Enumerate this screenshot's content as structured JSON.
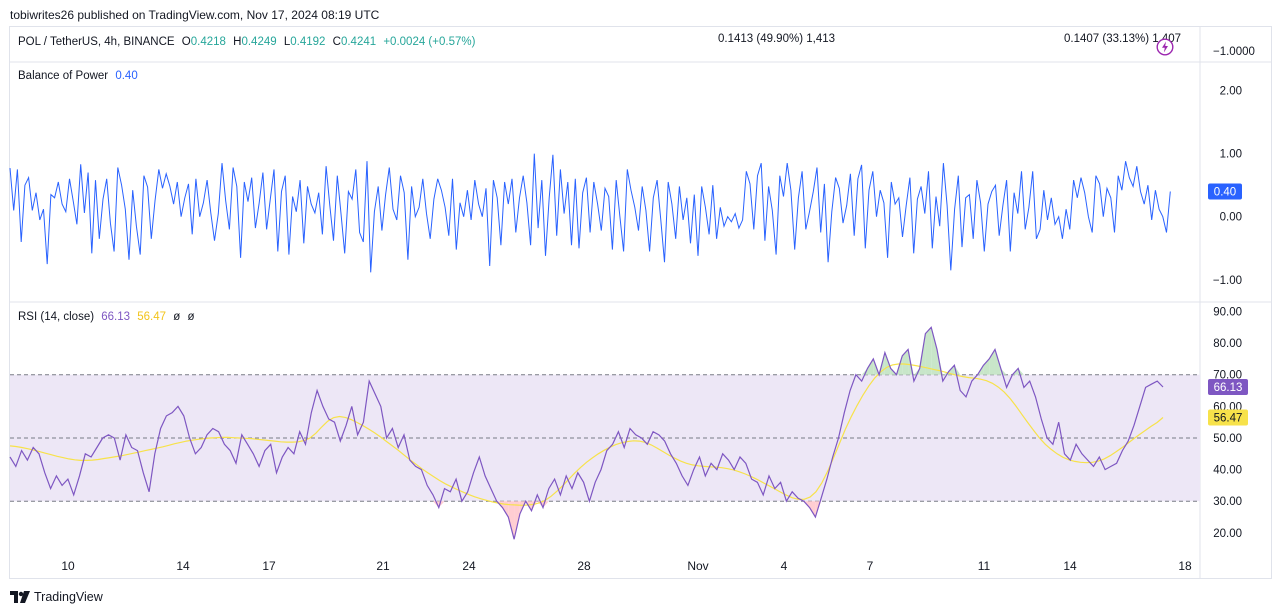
{
  "publisher_line": "tobiwrites26 published on TradingView.com, Nov 17, 2024 08:19 UTC",
  "header": {
    "symbol": "POL / TetherUS, 4h, BINANCE",
    "open_label": "O",
    "open": "0.4218",
    "high_label": "H",
    "high": "0.4249",
    "low_label": "L",
    "low": "0.4192",
    "close_label": "C",
    "close": "0.4241",
    "change": "+0.0024 (+0.57%)",
    "mid_info": "0.1413 (49.90%) 1,413",
    "right_info": "0.1407 (33.13%) 1,407",
    "right_axis_value": "−1.0000"
  },
  "colors": {
    "bop_line": "#2962ff",
    "rsi_line": "#7e57c2",
    "rsi_ma": "#f7e24a",
    "rsi_band": "#ede7f6",
    "overbought_fill": "#c8e6c9",
    "oversold_fill": "#ffcdd2",
    "gain": "#26a69a",
    "alert": "#9c27b0"
  },
  "footer": {
    "brand": "TradingView",
    "logo_icon": "tradingview-logo-icon"
  },
  "chart_data": [
    {
      "type": "line",
      "title": "Balance of Power",
      "current_value": "0.40",
      "yticks": [
        "2.00",
        "1.00",
        "0.00",
        "−1.00"
      ],
      "ylim": [
        -1.35,
        2.45
      ],
      "series": [
        {
          "values": [
            0.77,
            0.1,
            0.75,
            -0.4,
            0.5,
            0.62,
            0.1,
            0.38,
            -0.05,
            0.12,
            -0.75,
            0.35,
            0.3,
            0.55,
            0.2,
            0.08,
            0.6,
            0.25,
            -0.12,
            0.83,
            0.06,
            0.7,
            -0.58,
            0.58,
            -0.35,
            0.28,
            0.6,
            -0.1,
            -0.55,
            0.78,
            0.5,
            0.12,
            -0.68,
            0.42,
            -0.15,
            -0.6,
            0.65,
            0.47,
            -0.35,
            0.25,
            0.75,
            0.45,
            0.68,
            0.48,
            0.2,
            0.55,
            0.0,
            0.3,
            0.52,
            -0.28,
            0.6,
            0.0,
            0.22,
            0.58,
            0.06,
            -0.38,
            0.05,
            0.85,
            0.25,
            -0.2,
            0.78,
            0.48,
            -0.65,
            0.55,
            0.24,
            0.62,
            -0.18,
            0.22,
            0.7,
            -0.2,
            0.28,
            0.75,
            -0.55,
            0.4,
            0.65,
            -0.6,
            0.32,
            0.08,
            0.58,
            -0.42,
            0.48,
            0.2,
            0.06,
            0.38,
            -0.28,
            0.8,
            0.18,
            -0.38,
            0.65,
            0.05,
            -0.58,
            0.4,
            0.28,
            0.75,
            -0.25,
            -0.4,
            0.88,
            -0.88,
            0.08,
            0.48,
            -0.22,
            0.35,
            0.78,
            0.12,
            -0.05,
            0.65,
            0.38,
            -0.68,
            0.48,
            0.0,
            0.15,
            0.6,
            0.05,
            -0.35,
            0.28,
            0.6,
            0.42,
            0.15,
            -0.3,
            0.6,
            -0.52,
            0.22,
            0.0,
            0.42,
            -0.05,
            0.58,
            0.2,
            0.0,
            0.45,
            -0.78,
            0.58,
            0.3,
            -0.45,
            0.55,
            0.2,
            0.6,
            -0.25,
            0.3,
            0.65,
            0.22,
            -0.45,
            1.0,
            -0.18,
            0.58,
            -0.62,
            0.3,
            0.98,
            -0.3,
            0.75,
            0.05,
            0.55,
            -0.45,
            0.6,
            -0.5,
            0.38,
            0.62,
            -0.25,
            0.55,
            0.2,
            -0.22,
            0.45,
            0.32,
            -0.52,
            0.58,
            0.0,
            -0.55,
            0.75,
            0.42,
            0.15,
            -0.22,
            0.48,
            0.1,
            -0.55,
            0.3,
            0.58,
            -0.05,
            -0.72,
            0.55,
            0.2,
            -0.35,
            0.48,
            -0.05,
            0.3,
            -0.42,
            0.35,
            -0.62,
            0.48,
            0.15,
            -0.28,
            0.5,
            -0.35,
            0.15,
            -0.15,
            0.0,
            -0.08,
            0.05,
            -0.18,
            -0.05,
            0.72,
            0.52,
            -0.2,
            0.65,
            0.85,
            -0.38,
            0.48,
            0.1,
            -0.6,
            0.65,
            0.32,
            0.85,
            0.42,
            -0.52,
            0.3,
            0.72,
            -0.2,
            0.08,
            0.4,
            0.78,
            -0.25,
            0.52,
            -0.72,
            0.08,
            0.62,
            0.45,
            -0.1,
            0.18,
            0.68,
            -0.3,
            0.6,
            0.82,
            -0.5,
            0.42,
            0.72,
            0.0,
            0.42,
            0.22,
            -0.65,
            0.55,
            0.2,
            0.3,
            -0.32,
            0.18,
            0.62,
            -0.58,
            0.28,
            0.48,
            0.05,
            0.72,
            -0.5,
            0.32,
            -0.15,
            0.85,
            0.18,
            -0.85,
            0.12,
            0.65,
            -0.48,
            0.3,
            0.35,
            -0.35,
            0.58,
            0.22,
            -0.55,
            0.2,
            0.4,
            0.5,
            -0.3,
            0.18,
            0.58,
            -0.55,
            0.38,
            0.05,
            0.72,
            -0.2,
            0.15,
            0.72,
            -0.35,
            -0.2,
            0.42,
            -0.05,
            0.3,
            -0.12,
            0.0,
            -0.35,
            0.12,
            -0.2,
            0.58,
            0.3,
            0.62,
            0.38,
            0.0,
            -0.25,
            0.65,
            0.52,
            0.0,
            0.45,
            0.3,
            -0.25,
            0.65,
            0.42,
            0.88,
            0.62,
            0.48,
            0.8,
            0.4,
            0.2,
            0.5,
            -0.05,
            0.42,
            0.12,
            0.0,
            -0.25,
            0.4
          ]
        }
      ]
    },
    {
      "type": "line",
      "title": "RSI (14, close)",
      "values_label": [
        "66.13",
        "56.47",
        "ø",
        "ø"
      ],
      "yticks": [
        "90.00",
        "80.00",
        "70.00",
        "60.00",
        "50.00",
        "40.00",
        "30.00",
        "20.00"
      ],
      "ylim": [
        13,
        93
      ],
      "bands": {
        "upper": 70,
        "middle": 50,
        "lower": 30
      },
      "x_tick_labels": [
        "10",
        "14",
        "17",
        "21",
        "24",
        "28",
        "Nov",
        "4",
        "7",
        "11",
        "14",
        "18"
      ],
      "series": [
        {
          "values": [
            44,
            41,
            46,
            43,
            47,
            45,
            39,
            34,
            38,
            35,
            37,
            32,
            38,
            45,
            44,
            47,
            50,
            51,
            50,
            43,
            51,
            47,
            46,
            39,
            33,
            45,
            53,
            57,
            58,
            60,
            57,
            50,
            45,
            47,
            51,
            53,
            52,
            48,
            46,
            42,
            51,
            48,
            45,
            41,
            46,
            48,
            39,
            44,
            47,
            45,
            52,
            48,
            58,
            65,
            60,
            56,
            55,
            49,
            54,
            60,
            51,
            55,
            68,
            64,
            60,
            50,
            53,
            47,
            51,
            43,
            41,
            40,
            35,
            32,
            28,
            34,
            33,
            37,
            30,
            33,
            39,
            44,
            38,
            34,
            30,
            28,
            25,
            18,
            26,
            30,
            27,
            32,
            28,
            34,
            37,
            32,
            38,
            34,
            39,
            36,
            30,
            36,
            40,
            46,
            48,
            52,
            47,
            53,
            51,
            50,
            48,
            52,
            51,
            49,
            45,
            42,
            38,
            35,
            40,
            44,
            38,
            42,
            40,
            45,
            43,
            40,
            44,
            42,
            37,
            36,
            32,
            38,
            34,
            36,
            30,
            33,
            31,
            30,
            28,
            25,
            31,
            37,
            44,
            50,
            58,
            65,
            70,
            68,
            72,
            75,
            70,
            77,
            72,
            70,
            76,
            78,
            68,
            72,
            83,
            85,
            78,
            68,
            71,
            73,
            65,
            63,
            68,
            70,
            73,
            75,
            78,
            72,
            66,
            70,
            72,
            66,
            68,
            63,
            56,
            50,
            48,
            55,
            45,
            43,
            48,
            45,
            43,
            41,
            44,
            40,
            41,
            42,
            46,
            49,
            54,
            60,
            66,
            67,
            68,
            66.13
          ]
        },
        {
          "values": [
            47.5,
            47.3,
            47.0,
            46.6,
            46.2,
            45.7,
            45.2,
            44.7,
            44.2,
            43.8,
            43.4,
            43.1,
            42.9,
            42.9,
            43.0,
            43.2,
            43.5,
            43.8,
            44.1,
            44.4,
            44.8,
            45.2,
            45.6,
            46.0,
            46.4,
            46.8,
            47.2,
            47.7,
            48.2,
            48.6,
            49.0,
            49.3,
            49.6,
            49.8,
            50.0,
            50.1,
            50.2,
            50.2,
            50.1,
            50.0,
            49.9,
            49.8,
            49.6,
            49.4,
            49.2,
            49.0,
            48.8,
            48.7,
            48.7,
            48.8,
            49.2,
            50.0,
            51.5,
            53.5,
            55.3,
            56.4,
            56.8,
            56.5,
            55.8,
            54.9,
            53.9,
            52.8,
            51.6,
            50.3,
            48.9,
            47.5,
            46.1,
            44.6,
            43.1,
            41.7,
            40.3,
            39.0,
            37.8,
            36.6,
            35.5,
            34.6,
            33.7,
            32.9,
            32.1,
            31.4,
            30.8,
            30.3,
            29.8,
            29.4,
            29.1,
            28.9,
            28.8,
            28.7,
            28.8,
            29.0,
            29.5,
            30.3,
            31.6,
            33.2,
            35.0,
            37.0,
            38.9,
            40.7,
            42.3,
            43.7,
            45.0,
            46.1,
            47.1,
            47.9,
            48.5,
            48.9,
            49.1,
            49.0,
            48.6,
            47.8,
            46.8,
            45.7,
            44.6,
            43.6,
            42.7,
            42.0,
            41.5,
            41.2,
            41.0,
            40.9,
            40.8,
            40.6,
            40.3,
            39.9,
            39.3,
            38.6,
            37.8,
            36.9,
            35.9,
            34.9,
            33.9,
            32.9,
            31.9,
            31.1,
            30.6,
            30.6,
            31.3,
            33.0,
            35.8,
            39.5,
            43.8,
            48.3,
            52.7,
            56.7,
            60.3,
            63.6,
            66.5,
            69.0,
            70.9,
            72.3,
            73.1,
            73.4,
            73.4,
            73.2,
            72.9,
            72.5,
            72.1,
            71.7,
            71.3,
            70.8,
            70.3,
            69.8,
            69.4,
            69.1,
            68.9,
            68.6,
            68.1,
            67.3,
            66.1,
            64.5,
            62.5,
            60.1,
            57.5,
            54.9,
            52.4,
            50.0,
            48.0,
            46.4,
            45.0,
            43.9,
            43.1,
            42.6,
            42.3,
            42.2,
            42.3,
            42.7,
            43.4,
            44.4,
            45.6,
            46.9,
            48.3,
            49.7,
            51.1,
            52.4,
            53.7,
            54.9,
            56.47
          ]
        }
      ]
    }
  ]
}
